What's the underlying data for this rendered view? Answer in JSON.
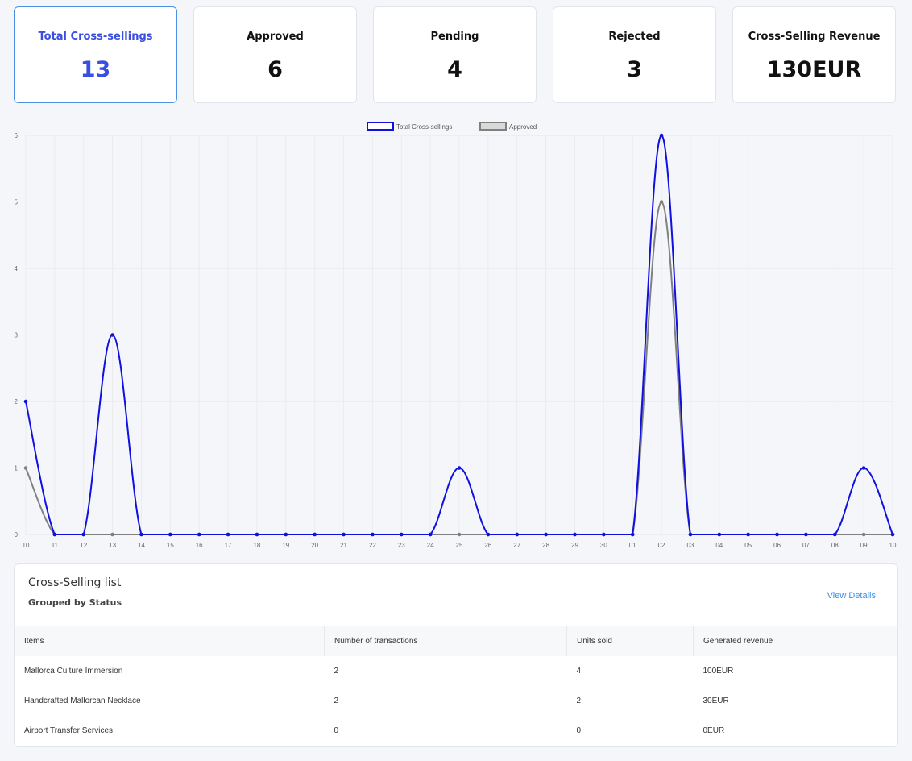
{
  "cards": [
    {
      "title": "Total Cross-sellings",
      "value": "13"
    },
    {
      "title": "Approved",
      "value": "6"
    },
    {
      "title": "Pending",
      "value": "4"
    },
    {
      "title": "Rejected",
      "value": "3"
    },
    {
      "title": "Cross-Selling Revenue",
      "value": "130EUR"
    }
  ],
  "chart_data": {
    "type": "line",
    "x": [
      "10",
      "11",
      "12",
      "13",
      "14",
      "15",
      "16",
      "17",
      "18",
      "19",
      "20",
      "21",
      "22",
      "23",
      "24",
      "25",
      "26",
      "27",
      "28",
      "29",
      "30",
      "01",
      "02",
      "03",
      "04",
      "05",
      "06",
      "07",
      "08",
      "09",
      "10"
    ],
    "series": [
      {
        "name": "Total Cross-sellings",
        "color": "#1010e0",
        "values": [
          2,
          0,
          0,
          3,
          0,
          0,
          0,
          0,
          0,
          0,
          0,
          0,
          0,
          0,
          0,
          1,
          0,
          0,
          0,
          0,
          0,
          0,
          6,
          0,
          0,
          0,
          0,
          0,
          0,
          1,
          0
        ]
      },
      {
        "name": "Approved",
        "color": "#808080",
        "values": [
          1,
          0,
          0,
          0,
          0,
          0,
          0,
          0,
          0,
          0,
          0,
          0,
          0,
          0,
          0,
          0,
          0,
          0,
          0,
          0,
          0,
          0,
          5,
          0,
          0,
          0,
          0,
          0,
          0,
          0,
          0
        ]
      }
    ],
    "ylim": [
      0,
      6
    ],
    "yticks": [
      "0",
      "1",
      "2",
      "3",
      "4",
      "5",
      "6"
    ],
    "legend": "top-center",
    "grid": true
  },
  "list": {
    "title": "Cross-Selling list",
    "subtitle": "Grouped by Status",
    "view_details": "View Details",
    "columns": [
      "Items",
      "Number of transactions",
      "Units sold",
      "Generated revenue"
    ],
    "rows": [
      [
        "Mallorca Culture Immersion",
        "2",
        "4",
        "100EUR"
      ],
      [
        "Handcrafted Mallorcan Necklace",
        "2",
        "2",
        "30EUR"
      ],
      [
        "Airport Transfer Services",
        "0",
        "0",
        "0EUR"
      ]
    ]
  }
}
